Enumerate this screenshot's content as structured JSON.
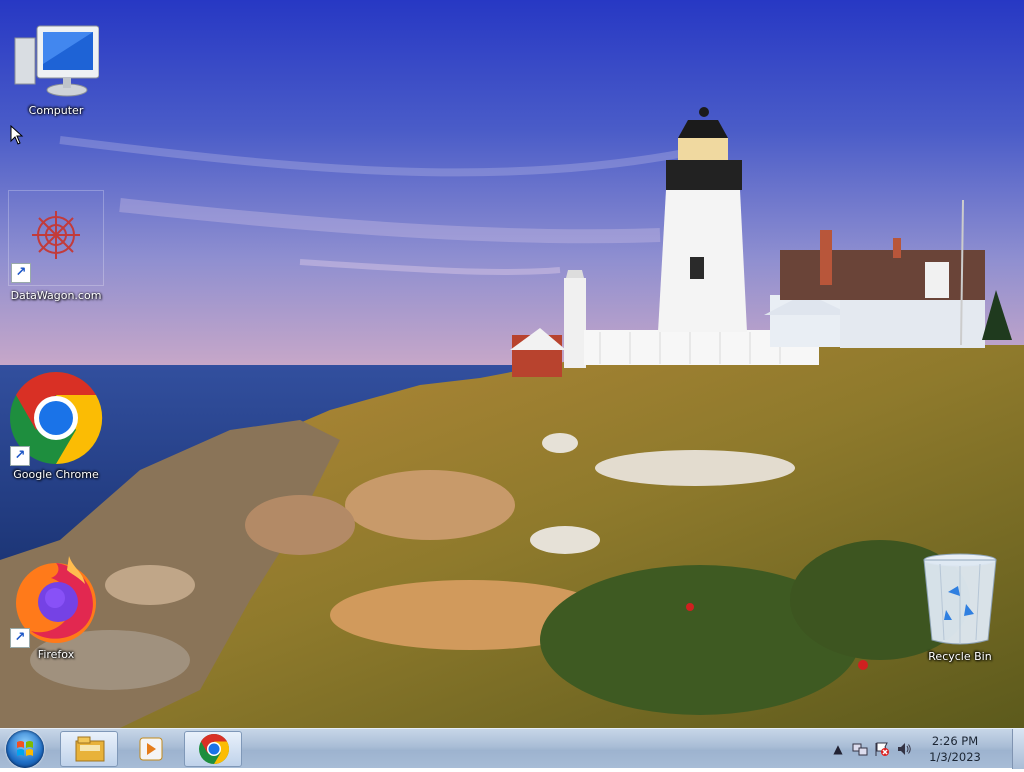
{
  "desktop": {
    "icons": [
      {
        "label": "Computer",
        "icon": "computer-icon",
        "shortcut": false
      },
      {
        "label": "DataWagon.com",
        "icon": "datawagon-icon",
        "shortcut": true
      },
      {
        "label": "Google Chrome",
        "icon": "chrome-icon",
        "shortcut": true
      },
      {
        "label": "Firefox",
        "icon": "firefox-icon",
        "shortcut": true
      },
      {
        "label": "Recycle Bin",
        "icon": "recycle-bin-icon",
        "shortcut": false
      }
    ],
    "wallpaper": "lighthouse-coast"
  },
  "taskbar": {
    "start_icon": "windows-start-icon",
    "pinned": [
      {
        "icon": "windows-explorer-icon"
      },
      {
        "icon": "media-player-icon"
      },
      {
        "icon": "chrome-icon"
      }
    ],
    "tray": {
      "icons": [
        "show-hidden-icons-icon",
        "network-icon",
        "action-center-icon",
        "volume-icon"
      ],
      "time": "2:26 PM",
      "date": "1/3/2023"
    }
  },
  "colors": {
    "taskbar": "#a9bdd6",
    "sky_top": "#2a3fbf",
    "sea": "#1f3f8c"
  }
}
